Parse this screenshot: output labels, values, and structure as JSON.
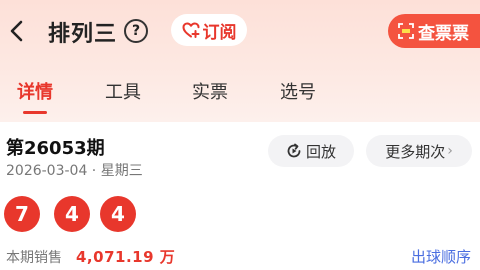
{
  "header": {
    "title": "排列三",
    "help_label": "?",
    "subscribe_label": "订阅",
    "check_ticket_label": "查票票"
  },
  "tabs": [
    {
      "label": "详情",
      "active": true
    },
    {
      "label": "工具",
      "active": false
    },
    {
      "label": "实票",
      "active": false
    },
    {
      "label": "选号",
      "active": false
    }
  ],
  "draw": {
    "issue": "第26053期",
    "date": "2026-03-04 · 星期三",
    "replay_label": "回放",
    "more_label": "更多期次",
    "more_chevron": "›",
    "numbers": [
      "7",
      "4",
      "4"
    ],
    "sales_label": "本期销售",
    "sales_value": "4,071.19 万",
    "order_label": "出球顺序"
  },
  "colors": {
    "accent": "#e8372c",
    "check_ticket_bg": "#f4533f",
    "link": "#4a6ee0"
  },
  "icons": [
    "back-arrow-icon",
    "heart-plus-icon",
    "ticket-scan-icon",
    "replay-icon"
  ]
}
